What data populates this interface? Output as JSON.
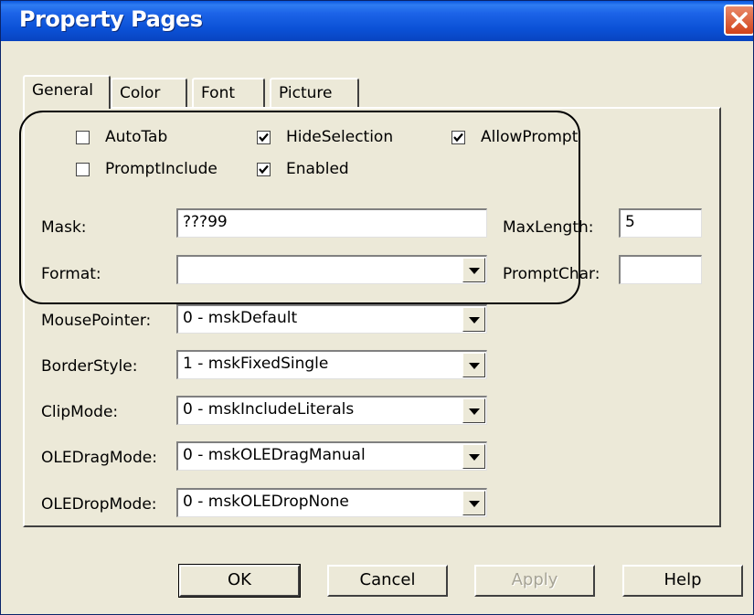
{
  "window": {
    "title": "Property Pages"
  },
  "tabs": [
    "General",
    "Color",
    "Font",
    "Picture"
  ],
  "checkboxes": {
    "autotab": {
      "label": "AutoTab",
      "checked": false
    },
    "hideselection": {
      "label": "HideSelection",
      "checked": true
    },
    "allowprompt": {
      "label": "AllowPrompt",
      "checked": true
    },
    "promptinclude": {
      "label": "PromptInclude",
      "checked": false
    },
    "enabled": {
      "label": "Enabled",
      "checked": true
    }
  },
  "fields": {
    "mask": {
      "label": "Mask:",
      "value": "???99"
    },
    "format": {
      "label": "Format:",
      "value": ""
    },
    "maxlength": {
      "label": "MaxLength:",
      "value": "5"
    },
    "promptchar": {
      "label": "PromptChar:",
      "value": ""
    },
    "mousepointer": {
      "label": "MousePointer:",
      "value": "0 - mskDefault"
    },
    "borderstyle": {
      "label": "BorderStyle:",
      "value": "1 - mskFixedSingle"
    },
    "clipmode": {
      "label": "ClipMode:",
      "value": "0 - mskIncludeLiterals"
    },
    "oledragmode": {
      "label": "OLEDragMode:",
      "value": "0 - mskOLEDragManual"
    },
    "oledropmode": {
      "label": "OLEDropMode:",
      "value": "0 - mskOLEDropNone"
    }
  },
  "buttons": {
    "ok": "OK",
    "cancel": "Cancel",
    "apply": "Apply",
    "help": "Help"
  },
  "colors": {
    "titlebar": "#0b51d6",
    "face": "#ece9d8",
    "close": "#d2421a"
  },
  "icons": {
    "close": "close-icon",
    "check": "checkmark-icon",
    "dropdown": "chevron-down-icon"
  }
}
